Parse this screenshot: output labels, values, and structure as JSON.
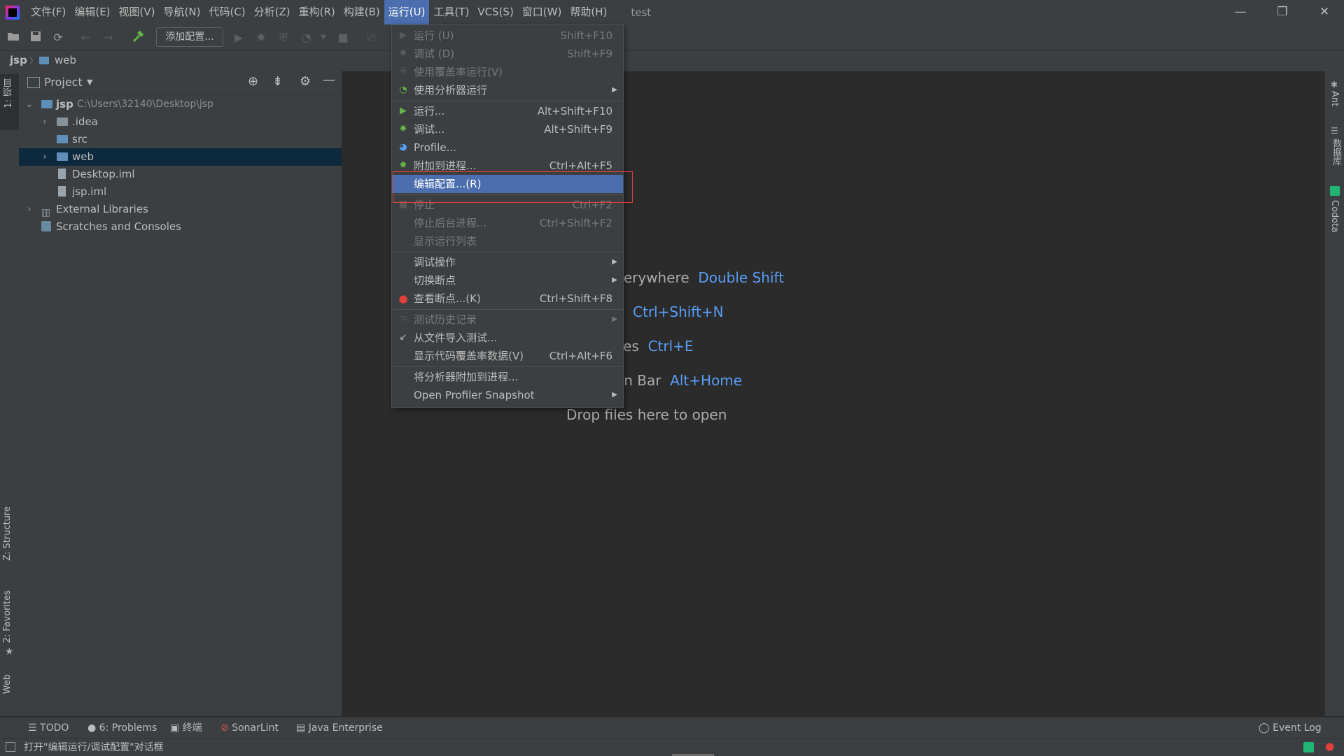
{
  "menubar": {
    "items": [
      "文件(F)",
      "编辑(E)",
      "视图(V)",
      "导航(N)",
      "代码(C)",
      "分析(Z)",
      "重构(R)",
      "构建(B)",
      "运行(U)",
      "工具(T)",
      "VCS(S)",
      "窗口(W)",
      "帮助(H)"
    ],
    "project_title": "test",
    "window_controls": [
      "—",
      "❐",
      "✕"
    ]
  },
  "toolbar": {
    "add_config_label": "添加配置..."
  },
  "breadcrumb": {
    "root": "jsp",
    "separator": "〉",
    "current": "web"
  },
  "left_stripe": {
    "tabs": [
      "1: 项目",
      "Z: Structure",
      "2: Favorites",
      "Web"
    ]
  },
  "project_panel": {
    "title": "Project",
    "tree": [
      {
        "name": "jsp",
        "path": "C:\\Users\\32140\\Desktop\\jsp",
        "expanded": true
      },
      {
        "name": ".idea"
      },
      {
        "name": "src"
      },
      {
        "name": "web",
        "selected": true
      },
      {
        "name": "Desktop.iml"
      },
      {
        "name": "jsp.iml"
      },
      {
        "name": "External Libraries"
      },
      {
        "name": "Scratches and Consoles"
      }
    ]
  },
  "editor_hints": [
    {
      "text": "verywhere",
      "key": "Double Shift"
    },
    {
      "text": "e",
      "key": "Ctrl+Shift+N"
    },
    {
      "text": "iles",
      "key": "Ctrl+E"
    },
    {
      "text": "on Bar",
      "key": "Alt+Home"
    },
    {
      "text": "Drop files here to open",
      "key": ""
    }
  ],
  "run_menu": {
    "items": [
      {
        "label": "运行 (U)",
        "shortcut": "Shift+F10",
        "icon": "run-icon",
        "disabled": true
      },
      {
        "label": "调试 (D)",
        "shortcut": "Shift+F9",
        "icon": "debug-icon",
        "disabled": true
      },
      {
        "label": "使用覆盖率运行(V)",
        "shortcut": "",
        "icon": "coverage-icon",
        "disabled": true
      },
      {
        "label": "使用分析器运行",
        "shortcut": "",
        "icon": "profiler-icon",
        "submenu": true
      },
      {
        "label": "运行...",
        "shortcut": "Alt+Shift+F10",
        "icon": "run-icon"
      },
      {
        "label": "调试...",
        "shortcut": "Alt+Shift+F9",
        "icon": "debug-icon"
      },
      {
        "label": "Profile...",
        "shortcut": "",
        "icon": "profile-icon"
      },
      {
        "label": "附加到进程...",
        "shortcut": "Ctrl+Alt+F5",
        "icon": "attach-icon"
      },
      {
        "label": "编辑配置...(R)",
        "shortcut": "",
        "icon": "",
        "highlighted": true
      },
      {
        "label": "停止",
        "shortcut": "Ctrl+F2",
        "icon": "stop-icon",
        "disabled": true
      },
      {
        "label": "停止后台进程...",
        "shortcut": "Ctrl+Shift+F2",
        "icon": "",
        "disabled": true
      },
      {
        "label": "显示运行列表",
        "shortcut": "",
        "icon": "",
        "disabled": true
      },
      {
        "label": "调试操作",
        "shortcut": "",
        "icon": "",
        "submenu": true
      },
      {
        "label": "切换断点",
        "shortcut": "",
        "icon": "",
        "submenu": true
      },
      {
        "label": "查看断点...(K)",
        "shortcut": "Ctrl+Shift+F8",
        "icon": "breakpoints-icon"
      },
      {
        "label": "测试历史记录",
        "shortcut": "",
        "icon": "history-icon",
        "disabled": true,
        "submenu": true
      },
      {
        "label": "从文件导入测试...",
        "shortcut": "",
        "icon": "import-tests-icon"
      },
      {
        "label": "显示代码覆盖率数据(V)",
        "shortcut": "Ctrl+Alt+F6",
        "icon": ""
      },
      {
        "label": "将分析器附加到进程...",
        "shortcut": "",
        "icon": ""
      },
      {
        "label": "Open Profiler Snapshot",
        "shortcut": "",
        "icon": "",
        "submenu": true
      }
    ]
  },
  "right_stripe": {
    "tabs": [
      "Ant",
      "数据库",
      "Codota"
    ]
  },
  "bottom_bar": {
    "items": [
      "TODO",
      "6: Problems",
      "终端",
      "SonarLint",
      "Java Enterprise"
    ],
    "event_log": "Event Log"
  },
  "status_bar": {
    "message": "打开\"编辑运行/调试配置\"对话框"
  },
  "colors": {
    "background": "#2b2b2b",
    "panel": "#3c3f41",
    "accent": "#4b6eaf",
    "selection": "#0d293e",
    "key_blue": "#589df6",
    "callout_red": "#e0403a"
  }
}
